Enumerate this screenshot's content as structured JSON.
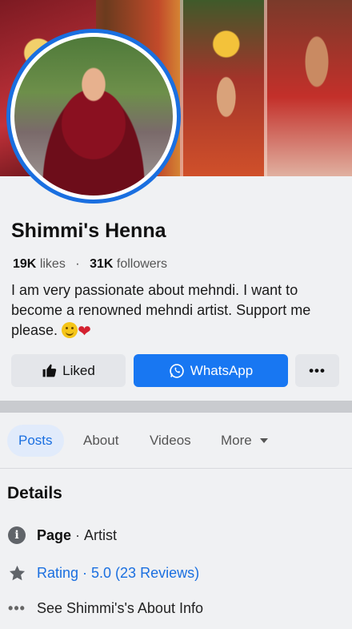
{
  "profile": {
    "name": "Shimmi's Henna",
    "likes_count": "19K",
    "likes_label": "likes",
    "followers_count": "31K",
    "followers_label": "followers",
    "bio": "I am very passionate about mehndi. I want to become a renowned mehndi artist. Support me please."
  },
  "actions": {
    "liked_label": "Liked",
    "whatsapp_label": "WhatsApp",
    "more_label": "•••"
  },
  "tabs": [
    {
      "label": "Posts",
      "active": true
    },
    {
      "label": "About"
    },
    {
      "label": "Videos"
    },
    {
      "label": "More"
    }
  ],
  "details": {
    "title": "Details",
    "page_label": "Page",
    "page_separator": "·",
    "page_value": "Artist",
    "rating_text": "Rating · 5.0 (23 Reviews)",
    "about_text": "See Shimmi's's About Info"
  },
  "colors": {
    "brand_blue": "#1877f2",
    "avatar_ring": "#1a6fe0",
    "button_gray": "#e4e6ea"
  },
  "icons": [
    "thumbs-up-icon",
    "whatsapp-icon",
    "more-dots-icon",
    "chevron-down-icon",
    "info-icon",
    "star-icon",
    "dots-icon"
  ]
}
